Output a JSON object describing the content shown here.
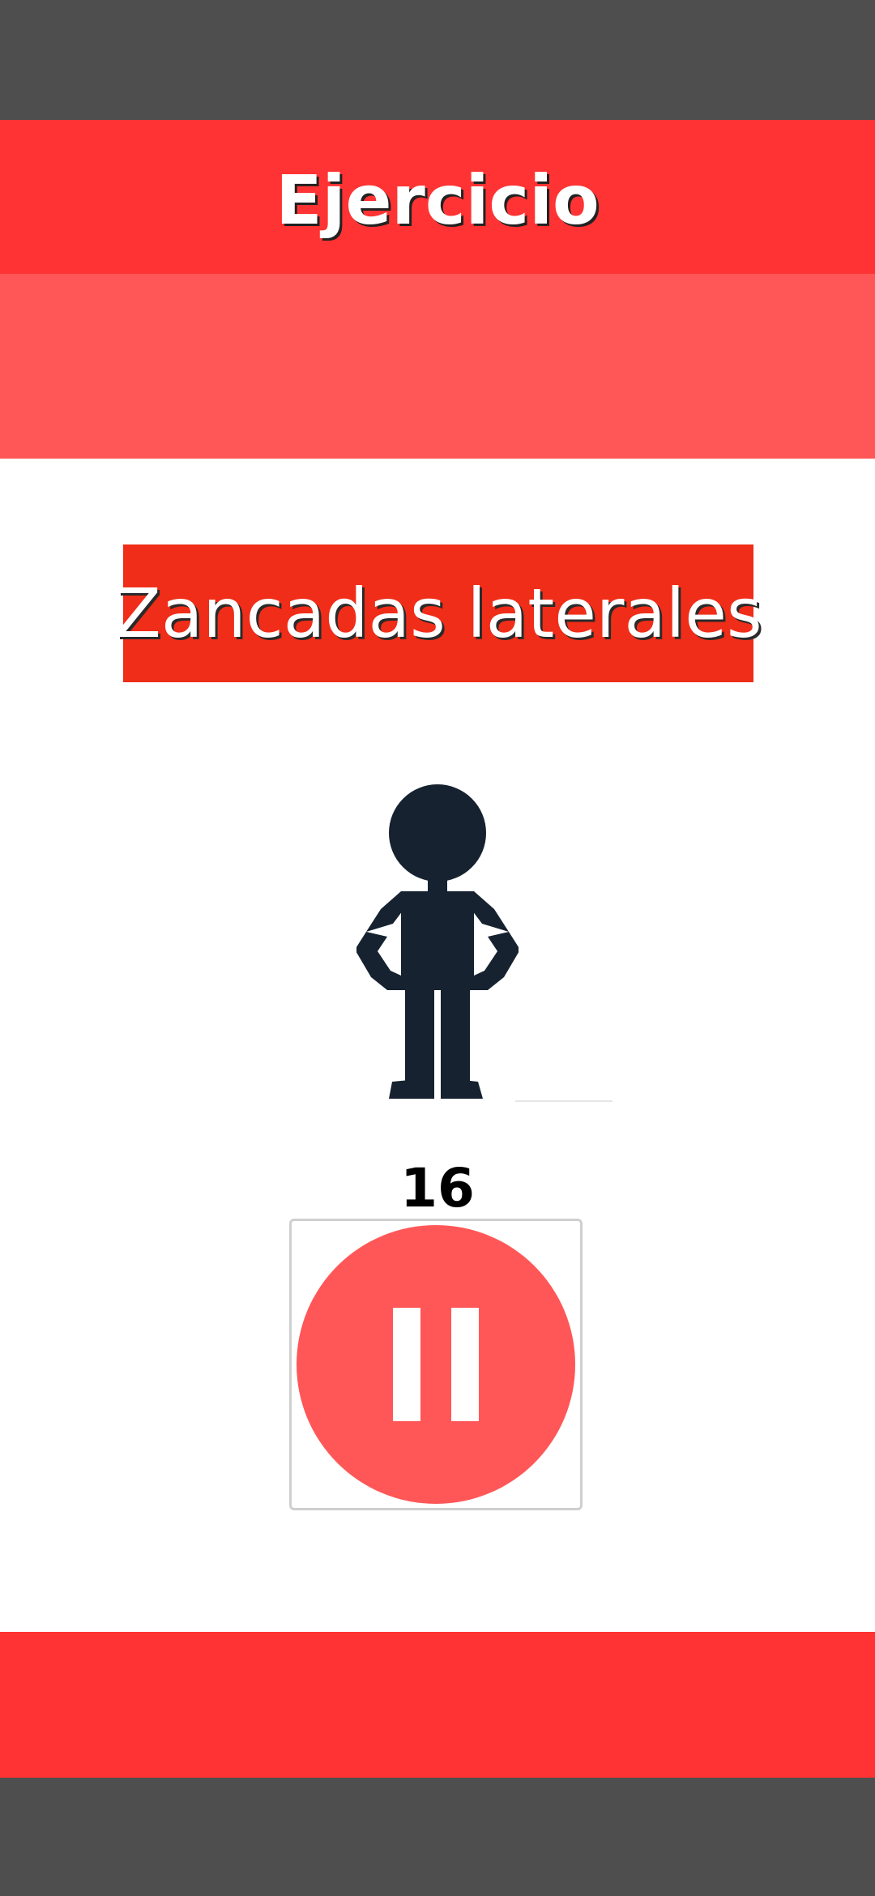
{
  "header": {
    "title": "Ejercicio"
  },
  "exercise": {
    "name": "Zancadas laterales",
    "illustration_icon": "stick-figure-icon",
    "counter": "16"
  },
  "controls": {
    "pause_icon": "pause-icon"
  },
  "colors": {
    "status_bar": "#4e4e4e",
    "title_bar": "#ff3333",
    "sub_bar": "#ff5757",
    "exercise_banner": "#f02d18",
    "figure": "#162230",
    "pause_circle": "#ff5757",
    "bottom_bar": "#ff3333",
    "nav_bar": "#4e4e4e"
  }
}
